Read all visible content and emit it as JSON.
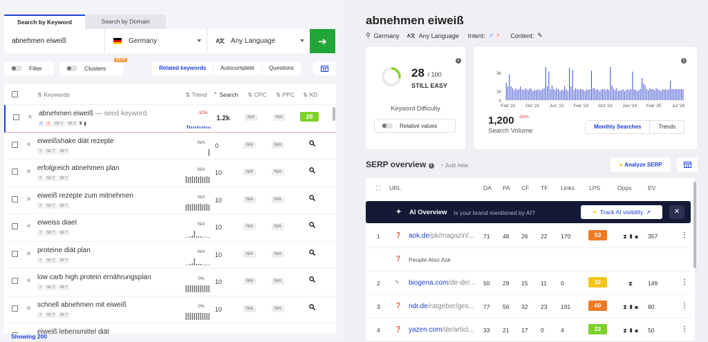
{
  "left": {
    "tabs": [
      {
        "label": "Search by Keyword"
      },
      {
        "label": "Search by Domain"
      }
    ],
    "search": {
      "keyword": "abnehmen eiweiß",
      "country": "Germany",
      "language": "Any Language"
    },
    "filters": {
      "filter_label": "Filter",
      "clusters_label": "Clusters",
      "beta": "BETA",
      "segments": [
        "Related keywords",
        "Autocomplete",
        "Questions"
      ]
    },
    "table": {
      "headers": {
        "keywords": "Keywords",
        "trend": "Trend",
        "search": "Search",
        "cpc": "CPC",
        "ppc": "PPC",
        "kd": "KD"
      },
      "rows": [
        {
          "keyword": "abnehmen eiweiß",
          "seed": "— seed keyword",
          "badges": [
            "I",
            "T",
            "SC 1",
            "SF 2"
          ],
          "trend": "-32%",
          "search": "1.2k",
          "cpc": "N/A",
          "ppc": "N/A",
          "kd": "28"
        },
        {
          "keyword": "eiweißshake diät rezepte",
          "badges": [
            "?",
            "SC ?",
            "SF ?"
          ],
          "trend": "N/A",
          "search": "0",
          "cpc": "N/A",
          "ppc": "N/A"
        },
        {
          "keyword": "erfolgreich abnehmen plan",
          "badges": [
            "?",
            "SC ?",
            "SF ?"
          ],
          "trend": "N/A",
          "search": "10",
          "cpc": "N/A",
          "ppc": "N/A"
        },
        {
          "keyword": "eiweiß rezepte zum mitnehmen",
          "badges": [
            "?",
            "SC ?",
            "SF ?"
          ],
          "trend": "N/A",
          "search": "10",
          "cpc": "N/A",
          "ppc": "N/A"
        },
        {
          "keyword": "eiweiss diaet",
          "badges": [
            "?",
            "SC ?",
            "SF ?"
          ],
          "trend": "N/A",
          "search": "10",
          "cpc": "N/A",
          "ppc": "N/A"
        },
        {
          "keyword": "proteine diät plan",
          "badges": [
            "?",
            "SC ?",
            "SF ?"
          ],
          "trend": "N/A",
          "search": "10",
          "cpc": "N/A",
          "ppc": "N/A"
        },
        {
          "keyword": "low carb high protein ernährungsplan",
          "badges": [
            "?",
            "SC ?",
            "SF ?"
          ],
          "trend": "0%",
          "search": "10",
          "cpc": "N/A",
          "ppc": "N/A"
        },
        {
          "keyword": "schnell abnehmen mit eiweiß",
          "badges": [
            "?",
            "SC ?",
            "SF ?"
          ],
          "trend": "0%",
          "search": "10",
          "cpc": "N/A",
          "ppc": "N/A"
        },
        {
          "keyword": "eiweiß lebensmittel diät"
        }
      ]
    },
    "showing": "Showing 200"
  },
  "right": {
    "title": "abnehmen eiweiß",
    "meta": {
      "country": "Germany",
      "language": "Any Language",
      "intent_label": "Intent:",
      "intent_badges": [
        "I",
        "T"
      ],
      "content_label": "Content:"
    },
    "kd_card": {
      "score": "28",
      "max": "/ 100",
      "verdict": "STILL EASY",
      "title": "Keyword Difficulty",
      "relative": "Relative values",
      "score_value": 28
    },
    "volume_card": {
      "value": "1,200",
      "change": "-32%",
      "label": "Search Volume",
      "monthly": "Monthly Searches",
      "trends": "Trends"
    },
    "chart_data": {
      "type": "bar",
      "y_ticks": [
        "3k",
        "1k",
        "0"
      ],
      "x_labels": [
        "Feb '21",
        "Oct '21",
        "Jun '22",
        "Feb '23",
        "Oct '23",
        "Jun '24",
        "Feb '25",
        "Jul '26"
      ],
      "values": [
        1900,
        1500,
        2800,
        1500,
        1300,
        1100,
        1300,
        1100,
        1200,
        1500,
        1200,
        1100,
        1300,
        1200,
        1100,
        1300,
        1200,
        1000,
        1100,
        1100,
        1200,
        1100,
        1100,
        1200,
        1300,
        3600,
        1500,
        3100,
        1200,
        1600,
        1200,
        1100,
        1300,
        1200,
        1000,
        1100,
        1100,
        1500,
        1200,
        1000,
        3500,
        1500,
        3300,
        1100,
        1300,
        1200,
        1100,
        1200,
        1200,
        1100,
        1000,
        1200,
        1100,
        1200,
        3200,
        1300,
        1300,
        1100,
        1200,
        1000,
        1100,
        1200,
        1200,
        1100,
        1200,
        1100,
        3600,
        1600,
        1200,
        1100,
        1300,
        1000,
        1100,
        1100,
        1200,
        1000,
        1100,
        1200,
        1100,
        1200,
        3100,
        1200,
        1100,
        1000,
        1100,
        1200,
        2400,
        1800,
        1600,
        1200,
        1100,
        1300,
        1200,
        1200,
        1100,
        1300,
        1200,
        1100,
        1000,
        1200,
        1100,
        1200,
        1100,
        1200,
        2100,
        1200,
        1200,
        1200,
        1200,
        1200,
        1200,
        1200,
        1200
      ]
    },
    "serp": {
      "title": "SERP overview",
      "time": "Just now",
      "analyze": "Analyze SERP",
      "headers": {
        "url": "URL",
        "da": "DA",
        "pa": "PA",
        "cf": "CF",
        "tf": "TF",
        "links": "Links",
        "lps": "LPS",
        "opps": "Opps",
        "ev": "EV"
      },
      "ai": {
        "title": "AI Overview",
        "question": "Is your brand mentioned by AI?",
        "track": "Track AI visibility"
      },
      "paa": "People Also Ask",
      "rows": [
        {
          "n": "1",
          "domain": "aok.de",
          "path": "/pk/magazin/...",
          "da": "71",
          "pa": "48",
          "cf": "26",
          "tf": "22",
          "links": "170",
          "lps": "53",
          "lps_color": "#ee7a24",
          "ev": "357"
        },
        {
          "n": "2",
          "domain": "biogena.com",
          "path": "/de-de/...",
          "da": "50",
          "pa": "29",
          "cf": "15",
          "tf": "11",
          "links": "0",
          "lps": "32",
          "lps_color": "#f5c518",
          "ev": "149"
        },
        {
          "n": "3",
          "domain": "ndr.de",
          "path": "/ratgeber/ges...",
          "da": "77",
          "pa": "56",
          "cf": "32",
          "tf": "23",
          "links": "191",
          "lps": "60",
          "lps_color": "#ee7a24",
          "ev": "80"
        },
        {
          "n": "4",
          "domain": "yazen.com",
          "path": "/de/articl...",
          "da": "33",
          "pa": "21",
          "cf": "17",
          "tf": "0",
          "links": "4",
          "lps": "22",
          "lps_color": "#7dd12a",
          "ev": "50"
        }
      ]
    }
  }
}
